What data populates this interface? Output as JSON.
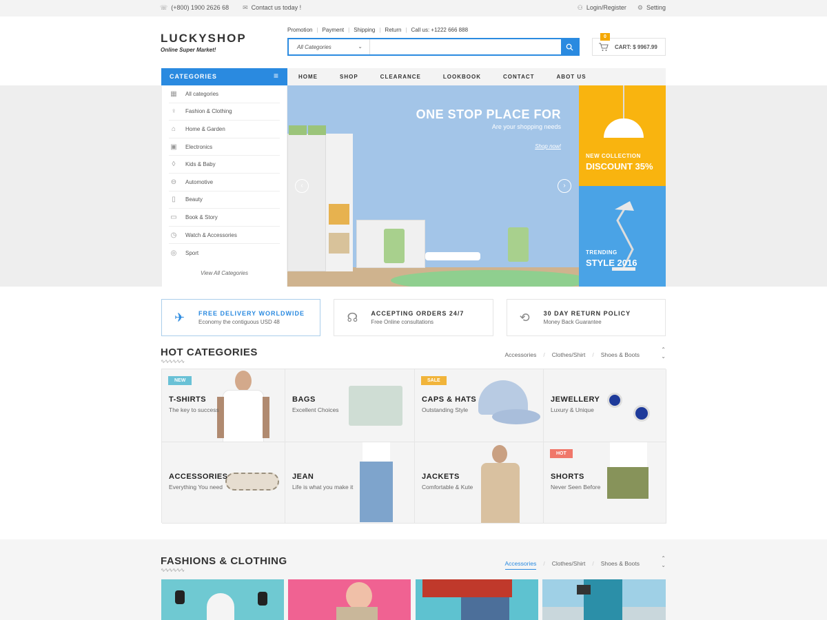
{
  "topbar": {
    "phone": "(+800) 1900 2626 68",
    "contact": "Contact us today !",
    "login": "Login/Register",
    "setting": "Setting"
  },
  "logo": {
    "name": "LUCKYSHOP",
    "tagline": "Online Super Market!"
  },
  "quicklinks": [
    "Promotion",
    "Payment",
    "Shipping",
    "Return"
  ],
  "call": "Call us: +1222 666 888",
  "search": {
    "category": "All Categories",
    "placeholder": ""
  },
  "cart": {
    "count": "0",
    "label": "CART: $ 9967.99"
  },
  "categories_label": "CATEGORIES",
  "menu": [
    "HOME",
    "SHOP",
    "CLEARANCE",
    "LOOKBOOK",
    "CONTACT",
    "ABOT US"
  ],
  "sidebar": {
    "items": [
      {
        "label": "All categories",
        "icon": "grid-icon"
      },
      {
        "label": "Fashion & Clothing",
        "icon": "dress-icon"
      },
      {
        "label": "Home & Garden",
        "icon": "sofa-icon"
      },
      {
        "label": "Electronics",
        "icon": "chip-icon"
      },
      {
        "label": "Kids & Baby",
        "icon": "bottle-icon"
      },
      {
        "label": "Automotive",
        "icon": "car-icon"
      },
      {
        "label": "Beauty",
        "icon": "lipstick-icon"
      },
      {
        "label": "Book & Story",
        "icon": "book-icon"
      },
      {
        "label": "Watch & Accessories",
        "icon": "clock-icon"
      },
      {
        "label": "Sport",
        "icon": "ball-icon"
      }
    ],
    "view_all": "View All Categories"
  },
  "banner": {
    "title": "ONE STOP PLACE FOR",
    "subtitle": "Are your shopping needs",
    "cta": "Shop now!"
  },
  "promo1": {
    "top": "NEW COLLECTION",
    "big": "DISCOUNT 35%"
  },
  "promo2": {
    "top": "TRENDING",
    "big": "STYLE 2016"
  },
  "services": [
    {
      "title": "FREE DELIVERY WORLDWIDE",
      "sub": "Economy the contiguous USD 48",
      "icon": "plane-icon"
    },
    {
      "title": "ACCEPTING ORDERS 24/7",
      "sub": "Free Online consultations",
      "icon": "headset-icon"
    },
    {
      "title": "30 DAY RETURN POLICY",
      "sub": "Money Back Guarantee",
      "icon": "return-icon"
    }
  ],
  "hot": {
    "title": "HOT CATEGORIES",
    "tabs": [
      "Accessories",
      "Clothes/Shirt",
      "Shoes & Boots"
    ],
    "cells": [
      {
        "name": "T-SHIRTS",
        "desc": "The key to success",
        "tag": "NEW",
        "tag_color": "#69c1d6"
      },
      {
        "name": "BAGS",
        "desc": "Excellent Choices"
      },
      {
        "name": "CAPS & HATS",
        "desc": "Outstanding  Style",
        "tag": "SALE",
        "tag_color": "#f1b43a"
      },
      {
        "name": "JEWELLERY",
        "desc": "Luxury & Unique"
      },
      {
        "name": "ACCESSORIES",
        "desc": "Everything You need"
      },
      {
        "name": "JEAN",
        "desc": "Life is what you make it"
      },
      {
        "name": "JACKETS",
        "desc": "Comfortable & Kute"
      },
      {
        "name": "SHORTS",
        "desc": "Never Seen Before",
        "tag": "HOT",
        "tag_color": "#f0776a"
      }
    ]
  },
  "fashion": {
    "title": "FASHIONS & CLOTHING",
    "tabs": [
      "Accessories",
      "Clothes/Shirt",
      "Shoes & Boots"
    ]
  },
  "colors": {
    "accent": "#2a8ae0",
    "promo_yellow": "#f9b40f",
    "promo_blue": "#4aa3e6"
  }
}
